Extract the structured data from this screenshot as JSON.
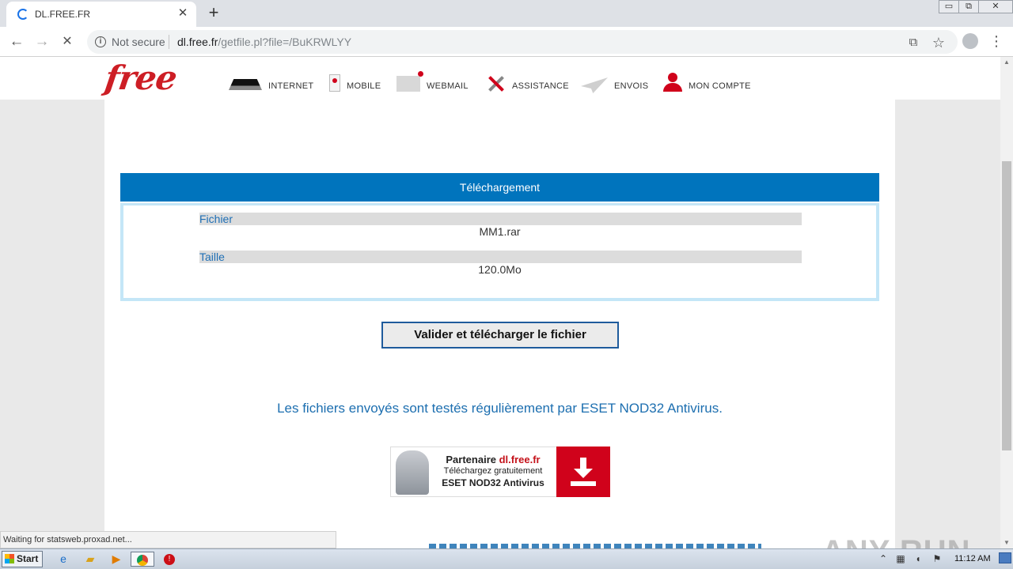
{
  "browser": {
    "tab_title": "DL.FREE.FR",
    "tab_close": "✕",
    "new_tab": "+",
    "window_controls": [
      "▭",
      "⧉",
      "✕"
    ],
    "back": "←",
    "forward": "→",
    "reload_stop": "✕",
    "not_secure": "Not secure",
    "url_host": "dl.free.fr",
    "url_path": "/getfile.pl?file=/BuKRWLYY",
    "translate_icon": "⧉",
    "bookmark_icon": "☆",
    "menu_icon": "⋮",
    "status_text": "Waiting for statsweb.proxad.net..."
  },
  "site": {
    "logo": "free",
    "nav": [
      {
        "label": "INTERNET",
        "icon": "freebox-icon"
      },
      {
        "label": "MOBILE",
        "icon": "mobile-icon"
      },
      {
        "label": "WEBMAIL",
        "icon": "mail-icon"
      },
      {
        "label": "ASSISTANCE",
        "icon": "tools-icon"
      },
      {
        "label": "ENVOIS",
        "icon": "paper-plane-icon"
      },
      {
        "label": "MON COMPTE",
        "icon": "user-icon"
      }
    ]
  },
  "download": {
    "heading": "Téléchargement",
    "file_label": "Fichier",
    "file_value": "MM1.rar",
    "size_label": "Taille",
    "size_value": "120.0Mo",
    "button": "Valider et télécharger le fichier",
    "note": "Les fichiers envoyés sont testés régulièrement par ESET NOD32 Antivirus."
  },
  "banner": {
    "title_prefix": "Partenaire ",
    "title_host": "dl.free.fr",
    "line2": "Téléchargez gratuitement",
    "line3": "ESET NOD32 Antivirus"
  },
  "watermark": "ANY RUN",
  "taskbar": {
    "start": "Start",
    "clock": "11:12 AM"
  },
  "colors": {
    "brand_red": "#cd1e25",
    "header_blue": "#0074bd",
    "text_blue": "#1d6fb0"
  }
}
